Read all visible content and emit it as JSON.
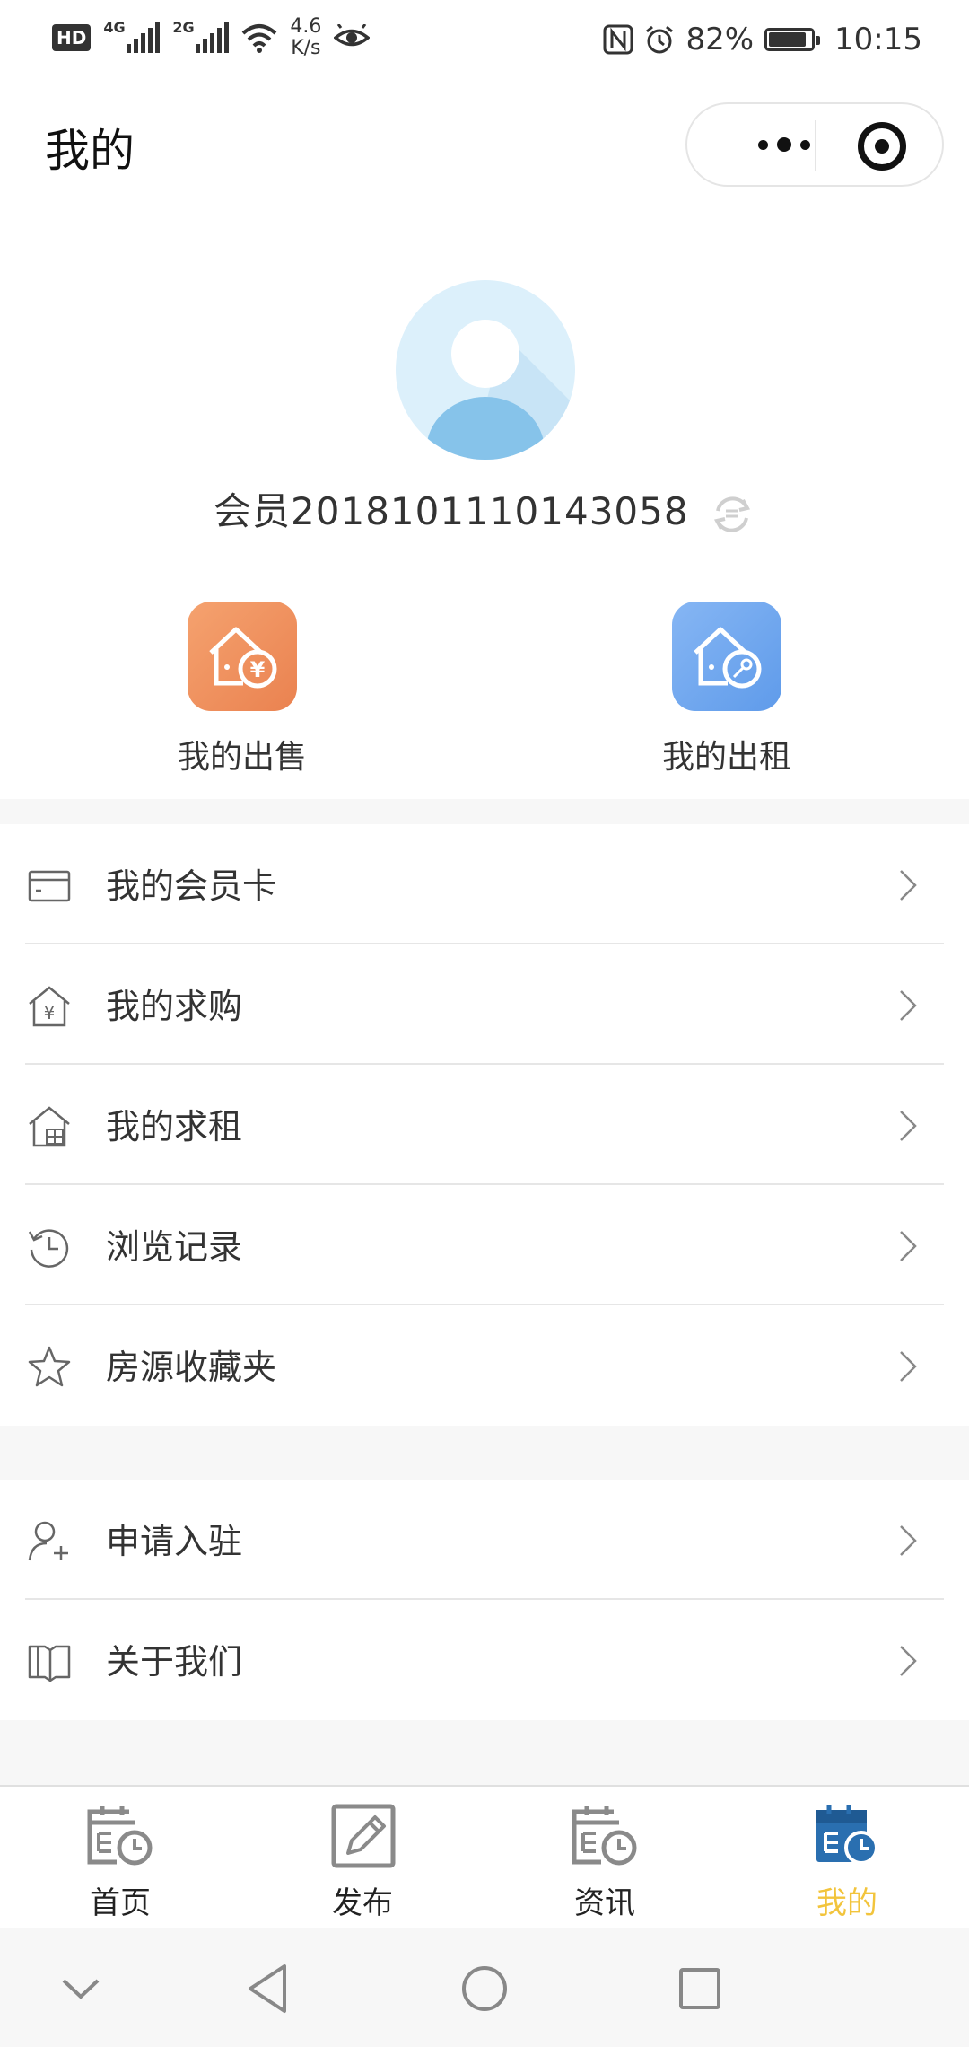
{
  "status_bar": {
    "hd": "HD",
    "net1": "4G",
    "net2": "2G",
    "speed_value": "4.6",
    "speed_unit": "K/s",
    "battery": "82%",
    "time": "10:15"
  },
  "header": {
    "title": "我的"
  },
  "profile": {
    "member_name": "会员2018101110143058"
  },
  "quick_actions": [
    {
      "label": "我的出售",
      "icon": "house-yen-icon",
      "color": "#ee8a59"
    },
    {
      "label": "我的出租",
      "icon": "house-key-icon",
      "color": "#6fa6ee"
    }
  ],
  "menu_group_1": [
    {
      "label": "我的会员卡",
      "icon": "card-icon"
    },
    {
      "label": "我的求购",
      "icon": "house-yen-outline-icon"
    },
    {
      "label": "我的求租",
      "icon": "house-rent-outline-icon"
    },
    {
      "label": "浏览记录",
      "icon": "history-icon"
    },
    {
      "label": "房源收藏夹",
      "icon": "star-icon"
    }
  ],
  "menu_group_2": [
    {
      "label": "申请入驻",
      "icon": "add-user-icon"
    },
    {
      "label": "关于我们",
      "icon": "book-icon"
    }
  ],
  "tab_bar": [
    {
      "label": "首页",
      "icon": "calendar-clock-icon",
      "active": false
    },
    {
      "label": "发布",
      "icon": "edit-icon",
      "active": false
    },
    {
      "label": "资讯",
      "icon": "calendar-clock-icon",
      "active": false
    },
    {
      "label": "我的",
      "icon": "calendar-clock-icon",
      "active": true
    }
  ],
  "colors": {
    "active_tab": "#f2c43c",
    "active_icon": "#2a6fb0",
    "sale_tile": "#ee8a59",
    "rent_tile": "#6fa6ee"
  }
}
